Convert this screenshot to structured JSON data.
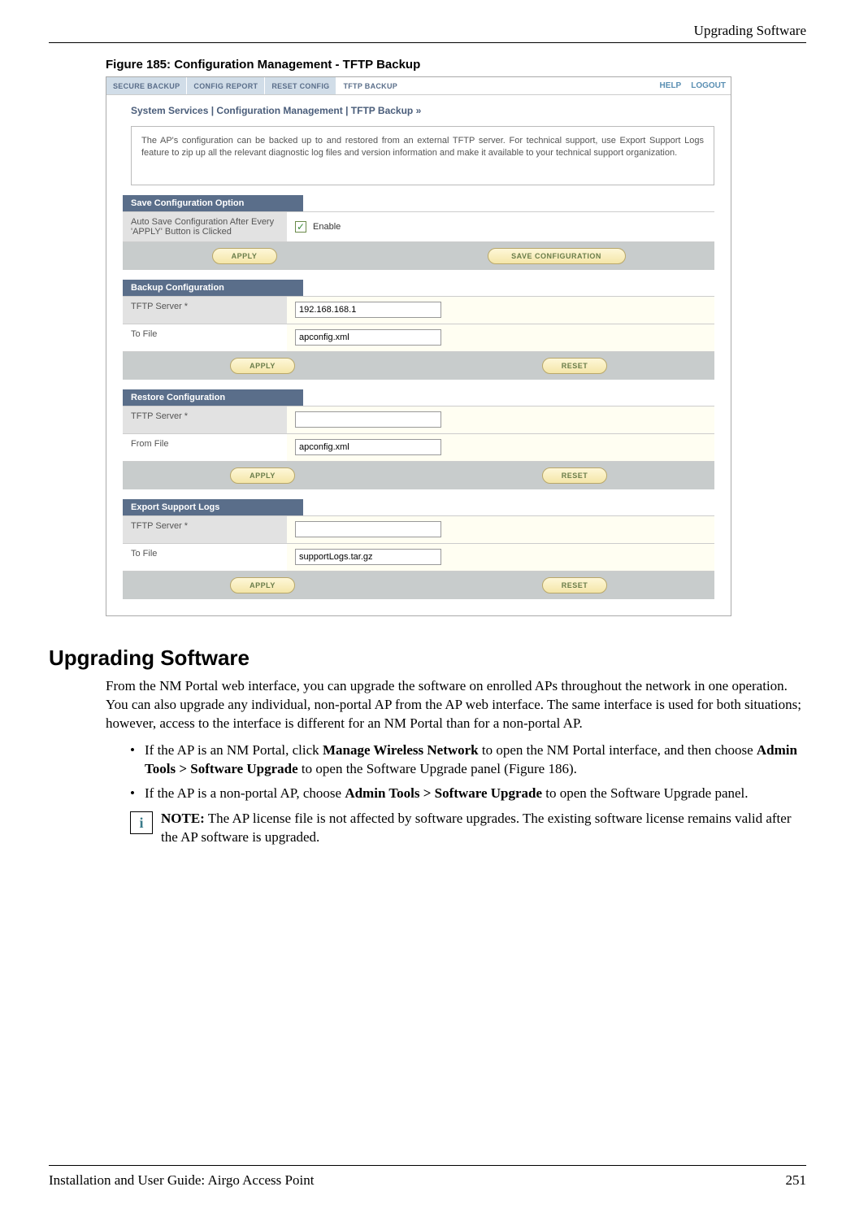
{
  "header": {
    "title": "Upgrading Software"
  },
  "figure": {
    "caption": "Figure 185:    Configuration Management - TFTP Backup"
  },
  "screenshot": {
    "tabs": {
      "secure": "SECURE BACKUP",
      "report": "CONFIG REPORT",
      "reset": "RESET CONFIG",
      "tftp": "TFTP BACKUP"
    },
    "help": "HELP",
    "logout": "LOGOUT",
    "breadcrumb": "System Services | Configuration Management | TFTP Backup  »",
    "description": "The AP's configuration can be backed up to and restored from an external TFTP server. For technical support, use Export Support Logs feature to zip up all the relevant diagnostic log files and version information and make it available to your technical support organization.",
    "save_option": {
      "title": "Save Configuration Option",
      "label": "Auto Save Configuration After Every 'APPLY' Button is Clicked",
      "enable": "Enable",
      "apply": "APPLY",
      "saveconf": "SAVE CONFIGURATION"
    },
    "backup": {
      "title": "Backup Configuration",
      "server_label": "TFTP Server  *",
      "server_value": "192.168.168.1",
      "file_label": "To File",
      "file_value": "apconfig.xml",
      "apply": "APPLY",
      "reset": "RESET"
    },
    "restore": {
      "title": "Restore Configuration",
      "server_label": "TFTP Server  *",
      "server_value": "",
      "file_label": "From File",
      "file_value": "apconfig.xml",
      "apply": "APPLY",
      "reset": "RESET"
    },
    "export": {
      "title": "Export Support Logs",
      "server_label": "TFTP Server  *",
      "server_value": "",
      "file_label": "To File",
      "file_value": "supportLogs.tar.gz",
      "apply": "APPLY",
      "reset": "RESET"
    }
  },
  "section": {
    "heading": "Upgrading Software",
    "para": "From the NM Portal web interface, you can upgrade the software on enrolled APs throughout the network in one operation. You can also upgrade any individual, non-portal AP from the AP web interface. The same interface is used for both situations; however, access to the interface is different for an NM Portal than for a non-portal AP.",
    "li1_a": "If the AP is an NM Portal, click ",
    "li1_b": "Manage Wireless Network",
    "li1_c": " to open the NM Portal interface, and then choose ",
    "li1_d": "Admin Tools > Software Upgrade",
    "li1_e": " to open the Software Upgrade panel (Figure 186).",
    "li2_a": "If the AP is a non-portal AP, choose ",
    "li2_b": "Admin Tools > Software Upgrade",
    "li2_c": " to open the Software Upgrade panel.",
    "note_label": "NOTE:",
    "note_text": " The AP license file is not affected by software upgrades. The existing software license remains valid after the AP software is upgraded."
  },
  "footer": {
    "left": "Installation and User Guide: Airgo Access Point",
    "right": "251"
  }
}
